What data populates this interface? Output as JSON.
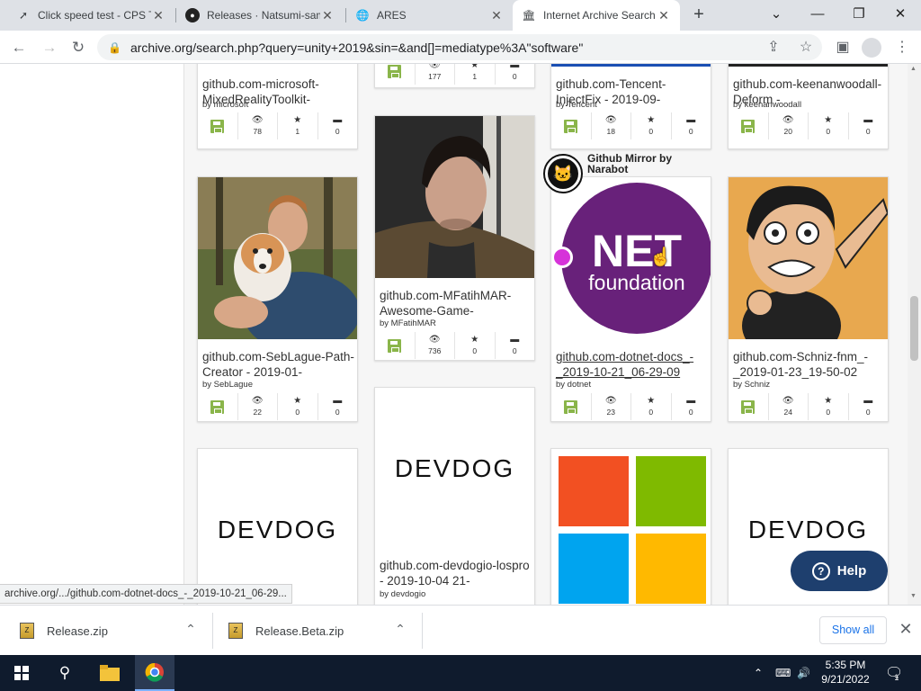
{
  "tabs": [
    {
      "title": "Click speed test - CPS T",
      "icon": "cursor-icon"
    },
    {
      "title": "Releases · Natsumi-sam",
      "icon": "github-icon"
    },
    {
      "title": "ARES",
      "icon": "globe-icon"
    },
    {
      "title": "Internet Archive Search",
      "icon": "archive-icon"
    }
  ],
  "address_bar": {
    "url": "archive.org/search.php?query=unity+2019&sin=&and[]=mediatype%3A\"software\""
  },
  "cards": [
    {
      "title": "github.com-microsoft-MixedRealityToolkit-",
      "by": "by microsoft",
      "views": "78",
      "favs": "1",
      "reviews": "0"
    },
    {
      "title": "",
      "by": "",
      "views": "177",
      "favs": "1",
      "reviews": "0"
    },
    {
      "title": "github.com-Tencent-InjectFix - 2019-09-",
      "by": "by Tencent",
      "views": "18",
      "favs": "0",
      "reviews": "0"
    },
    {
      "title": "github.com-keenanwoodall-Deform -",
      "by": "by keenanwoodall",
      "views": "20",
      "favs": "0",
      "reviews": "0"
    },
    {
      "title": "github.com-SebLague-Path-Creator - 2019-01-",
      "by": "by SebLague",
      "views": "22",
      "favs": "0",
      "reviews": "0"
    },
    {
      "title": "github.com-MFatihMAR-Awesome-Game-",
      "by": "by MFatihMAR",
      "views": "736",
      "favs": "0",
      "reviews": "0"
    },
    {
      "title": "github.com-dotnet-docs_-_2019-10-21_06-29-09",
      "by": "by dotnet",
      "views": "23",
      "favs": "0",
      "reviews": "0"
    },
    {
      "title": "github.com-Schniz-fnm_-_2019-01-23_19-50-02",
      "by": "by Schniz",
      "views": "24",
      "favs": "0",
      "reviews": "0"
    },
    {
      "title": "github.com-devdogio-lospro - 2019-10-04 21-",
      "by": "by devdogio"
    }
  ],
  "collection_badge": {
    "label": "Github Mirror by Narabot"
  },
  "thumb_text": {
    "devdog": "DEVDOG",
    "net": "NET",
    "foundation": "foundation"
  },
  "help_button": {
    "label": "Help"
  },
  "status_url": "archive.org/.../github.com-dotnet-docs_-_2019-10-21_06-29...",
  "downloads": [
    {
      "name": "Release.zip"
    },
    {
      "name": "Release.Beta.zip"
    }
  ],
  "show_all": "Show all",
  "clock": {
    "time": "5:35 PM",
    "date": "9/21/2022"
  },
  "notification_count": "1",
  "colors": {
    "net_purple": "#68217a",
    "floppy_green": "#8ab54a",
    "help_navy": "#1e3f6e",
    "taskbar": "#0f1b2d"
  }
}
